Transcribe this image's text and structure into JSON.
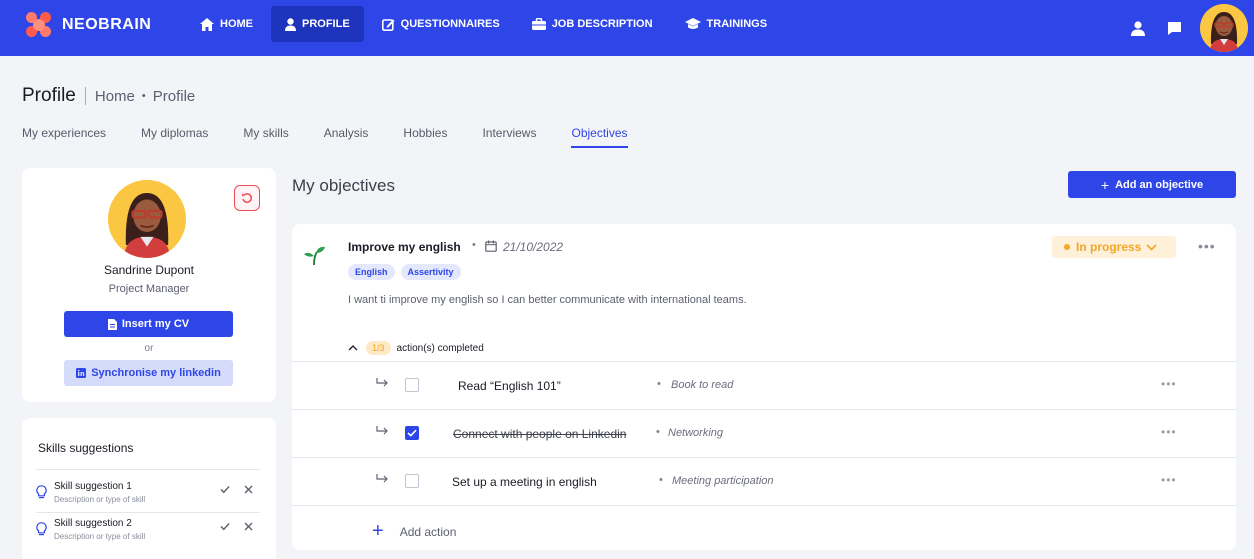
{
  "brand": {
    "name": "NEOBRAIN"
  },
  "nav": {
    "items": [
      {
        "label": "HOME",
        "icon": "home-icon"
      },
      {
        "label": "PROFILE",
        "icon": "user-icon",
        "active": true
      },
      {
        "label": "QUESTIONNAIRES",
        "icon": "edit-icon"
      },
      {
        "label": "JOB DESCRIPTION",
        "icon": "briefcase-icon"
      },
      {
        "label": "TRAININGS",
        "icon": "graduation-cap-icon"
      }
    ]
  },
  "header": {
    "title": "Profile",
    "breadcrumb": [
      "Home",
      "Profile"
    ]
  },
  "tabs": [
    "My experiences",
    "My diplomas",
    "My skills",
    "Analysis",
    "Hobbies",
    "Interviews",
    "Objectives"
  ],
  "profile": {
    "name": "Sandrine Dupont",
    "role": "Project Manager",
    "insert_cv_label": "Insert my CV",
    "or_label": "or",
    "linkedin_label": "Synchronise my linkedin"
  },
  "skills": {
    "title": "Skills suggestions",
    "items": [
      {
        "name": "Skill suggestion 1",
        "desc": "Description or type of skill"
      },
      {
        "name": "Skill suggestion 2",
        "desc": "Description or type of skill"
      }
    ]
  },
  "objectives": {
    "title": "My objectives",
    "add_label": "Add an objective",
    "item": {
      "name": "Improve my english",
      "date": "21/10/2022",
      "tags": [
        "English",
        "Assertivity"
      ],
      "description": "I want ti improve my english so I can better communicate with international teams.",
      "status": "In progress",
      "actions_count": "1/3",
      "actions_label": "action(s) completed",
      "actions": [
        {
          "name": "Read “English 101”",
          "type": "Book to read",
          "done": false
        },
        {
          "name": "Connect with people on Linkedin",
          "type": "Networking",
          "done": true
        },
        {
          "name": "Set up a meeting in english",
          "type": "Meeting participation",
          "done": false
        }
      ],
      "add_action_label": "Add action"
    }
  },
  "colors": {
    "primary": "#2e46e8",
    "status": "#f5a623",
    "danger": "#e94d5a"
  }
}
